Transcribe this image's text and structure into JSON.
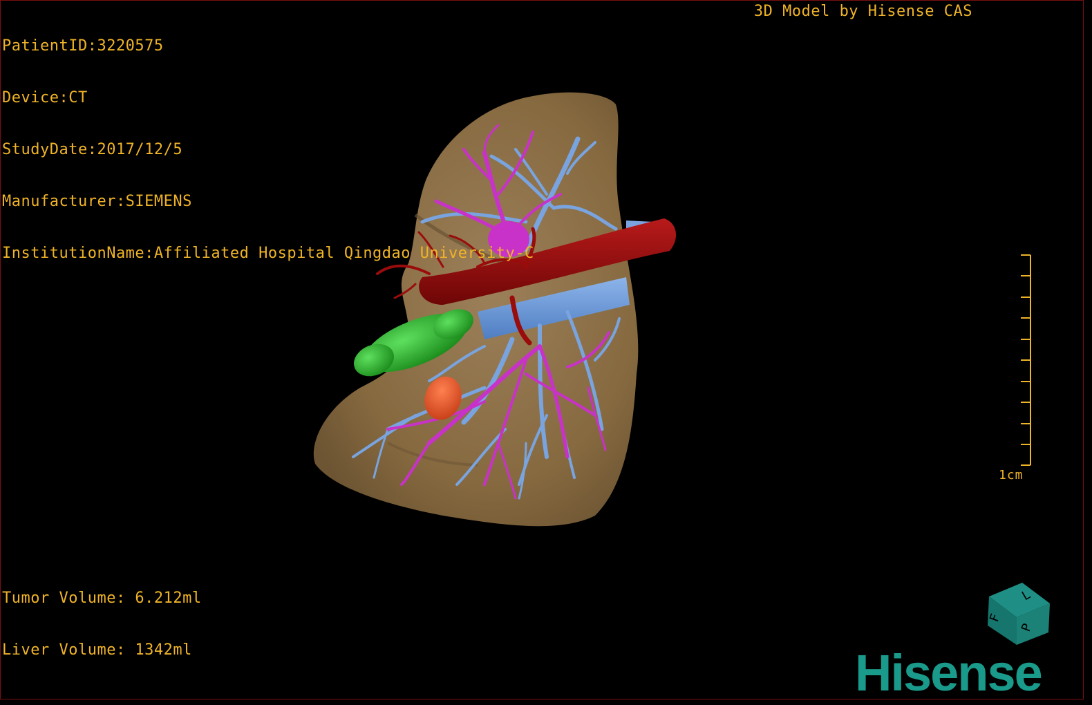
{
  "app": {
    "brand_title": "3D Model by Hisense CAS",
    "logo_text": "Hisense"
  },
  "dicom": {
    "patient_id": "PatientID:3220575",
    "device": "Device:CT",
    "study_date": "StudyDate:2017/12/5",
    "manufacturer": "Manufacturer:SIEMENS",
    "institution": "InstitutionName:Affiliated Hospital Qingdao University-C"
  },
  "measurements": {
    "tumor_volume": "Tumor Volume: 6.212ml",
    "liver_volume": "Liver Volume: 1342ml"
  },
  "scale_bar": {
    "label": "1cm"
  },
  "orientation_cube": {
    "faces": [
      "F",
      "L",
      "P"
    ]
  },
  "colors": {
    "overlay_text": "#f0b428",
    "liver": "#8b6f47",
    "portal_vein": "#6f9ad8",
    "hepatic_vein": "#c832c8",
    "artery": "#9a0c0c",
    "gallbladder": "#2dbb2d",
    "tumor": "#e8552a",
    "brand": "#1a9a8a"
  },
  "structures": [
    {
      "name": "liver",
      "icon": "liver-model"
    },
    {
      "name": "portal-vein",
      "icon": "vessel-tree"
    },
    {
      "name": "hepatic-vein",
      "icon": "vessel-tree"
    },
    {
      "name": "artery",
      "icon": "vessel"
    },
    {
      "name": "gallbladder",
      "icon": "organ"
    },
    {
      "name": "tumor",
      "icon": "lesion"
    }
  ]
}
